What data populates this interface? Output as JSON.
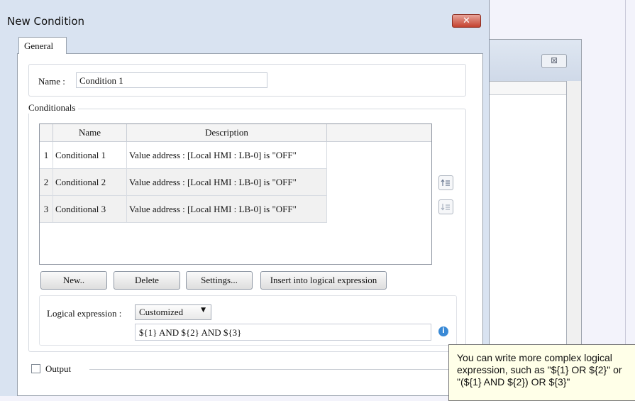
{
  "dialog": {
    "title": "New Condition",
    "close_symbol": "✕",
    "tab": "General"
  },
  "background_window": {
    "close_symbol": "⊠"
  },
  "name": {
    "label": "Name :",
    "value": "Condition 1"
  },
  "conditionals": {
    "group_label": "Conditionals",
    "columns": [
      "Name",
      "Description"
    ],
    "rows": [
      {
        "index": "1",
        "name": "Conditional 1",
        "description": "Value address : [Local HMI : LB-0] is \"OFF\""
      },
      {
        "index": "2",
        "name": "Conditional 2",
        "description": "Value address : [Local HMI : LB-0] is \"OFF\""
      },
      {
        "index": "3",
        "name": "Conditional 3",
        "description": "Value address : [Local HMI : LB-0] is \"OFF\""
      }
    ],
    "move_up_icon": "move-up-icon",
    "move_down_icon": "move-down-icon"
  },
  "buttons": {
    "new": "New..",
    "delete": "Delete",
    "settings": "Settings...",
    "insert": "Insert into logical expression"
  },
  "logical_expression": {
    "label": "Logical expression :",
    "mode": "Customized",
    "value": "${1} AND ${2} AND ${3}",
    "info_icon": "i"
  },
  "output": {
    "label": "Output",
    "checked": false
  },
  "tooltip": {
    "lines": [
      "You can write more complex logical",
      "expression, such as \"${1} OR ${2}\" or",
      "\"(${1} AND ${2}) OR ${3}\""
    ]
  }
}
